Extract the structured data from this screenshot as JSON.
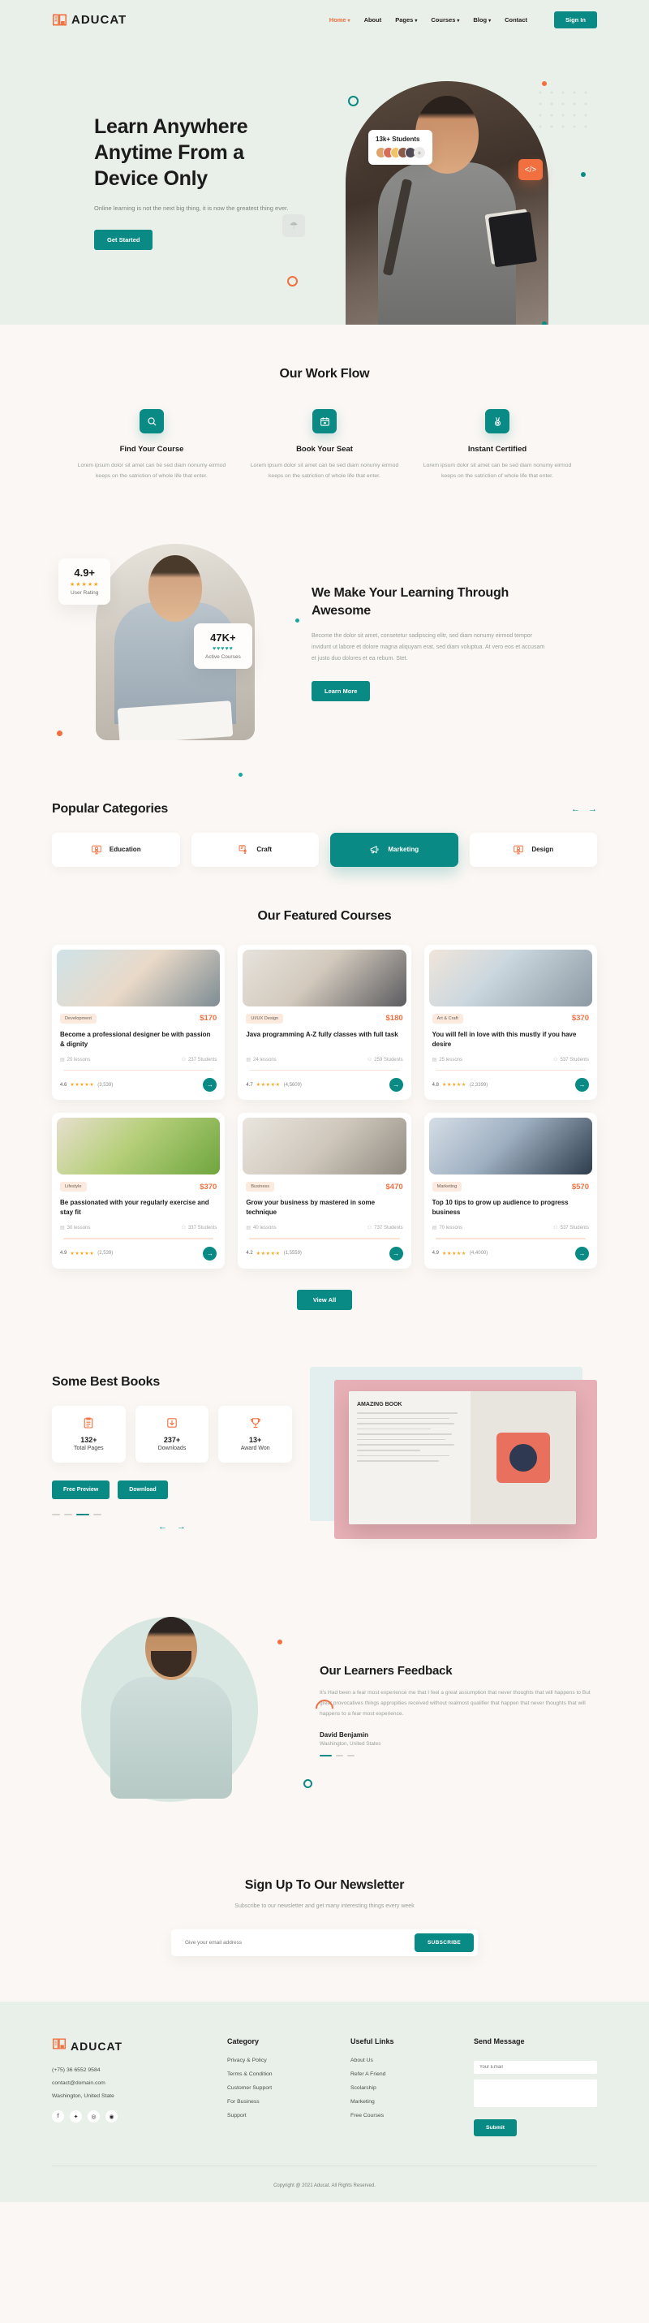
{
  "brand": {
    "name": "ADUCAT",
    "accent_teal": "#0a8a84",
    "accent_orange": "#f2703f"
  },
  "header": {
    "nav": [
      {
        "label": "Home",
        "caret": "▾",
        "active": true
      },
      {
        "label": "About",
        "caret": "",
        "active": false
      },
      {
        "label": "Pages",
        "caret": "▾",
        "active": false
      },
      {
        "label": "Courses",
        "caret": "▾",
        "active": false
      },
      {
        "label": "Blog",
        "caret": "▾",
        "active": false
      },
      {
        "label": "Contact",
        "caret": "",
        "active": false
      }
    ],
    "signin_label": "Sign In"
  },
  "hero": {
    "title": "Learn Anywhere Anytime From a Device Only",
    "subtitle": "Online learning is not the next big thing, it is now the greatest thing ever.",
    "cta": "Get Started",
    "students_badge": "13k+ Students",
    "more_avatars": "+",
    "code_icon": "</>",
    "grey_icon": "☂"
  },
  "workflow": {
    "title": "Our Work Flow",
    "items": [
      {
        "icon": "search-icon",
        "name": "Find Your Course",
        "desc": "Lorem ipsum dolor sit amet can be sed diam nonumy eirmod keeps on the satriction of whole life that enter."
      },
      {
        "icon": "calendar-icon",
        "name": "Book Your Seat",
        "desc": "Lorem ipsum dolor sit amet can be sed diam nonumy eirmod keeps on the satriction of whole life that enter."
      },
      {
        "icon": "medal-icon",
        "name": "Instant Certified",
        "desc": "Lorem ipsum dolor sit amet can be sed diam nonumy eirmod keeps on the satriction of whole life that enter."
      }
    ]
  },
  "learning": {
    "rating_value": "4.9+",
    "rating_stars": "★★★★★",
    "rating_caption": "User Rating",
    "courses_value": "47K+",
    "courses_hearts": "♥♥♥♥♥",
    "courses_caption": "Active Courses",
    "title": "We Make Your Learning Through Awesome",
    "paragraph": "Become the dolor sit amet, consetetur sadipscing elitr, sed diam nonumy eirmod tempor invidunt ut labore et dolore magna aliquyam erat, sed diam voluptua. At vero eos et accusam et justo duo dolores et ea rebum. Stet.",
    "cta": "Learn More"
  },
  "categories": {
    "title": "Popular Categories",
    "prev": "←",
    "next": "→",
    "items": [
      {
        "label": "Education",
        "icon": "monitor-badge-icon",
        "active": false
      },
      {
        "label": "Craft",
        "icon": "craft-icon",
        "active": false
      },
      {
        "label": "Marketing",
        "icon": "megaphone-icon",
        "active": true
      },
      {
        "label": "Design",
        "icon": "monitor-badge-icon",
        "active": false
      }
    ]
  },
  "courses": {
    "title": "Our Featured Courses",
    "view_all": "View All",
    "lessons_icon": "book-icon",
    "students_icon": "people-icon",
    "arrow_icon": "→",
    "items": [
      {
        "tag": "Development",
        "price": "$170",
        "title": "Become a professional designer be with passion & dignity",
        "lessons": "20 lessons",
        "students": "237 Students",
        "score": "4.6",
        "stars": "★★★★★",
        "count": "(3,539)",
        "thumb": "linear-gradient(135deg,#cfe3e8 0%,#e9d9c8 48%,#7d8c93 100%)"
      },
      {
        "tag": "UI/UX Design",
        "price": "$180",
        "title": "Java programming A-Z fully classes with full task",
        "lessons": "24 lessons",
        "students": "259 Students",
        "score": "4.7",
        "stars": "★★★★★",
        "count": "(4,5609)",
        "thumb": "linear-gradient(135deg,#e6e2dc 0%,#d3cabd 45%,#5b5b5f 100%)"
      },
      {
        "tag": "Art & Craft",
        "price": "$370",
        "title": "You will fell in love with this mustly if you have desire",
        "lessons": "25 lessons",
        "students": "537 Students",
        "score": "4.8",
        "stars": "★★★★★",
        "count": "(2,3399)",
        "thumb": "linear-gradient(135deg,#f0e5da 0%,#cbd7df 40%,#8e9aa3 100%)"
      },
      {
        "tag": "Lifestyle",
        "price": "$370",
        "title": "Be passionated with your regularly exercise and stay fit",
        "lessons": "30 lessons",
        "students": "337 Students",
        "score": "4.9",
        "stars": "★★★★★",
        "count": "(2,539)",
        "thumb": "linear-gradient(135deg,#e8dfcf 0%,#b6cf7a 45%,#6ea53e 100%)"
      },
      {
        "tag": "Business",
        "price": "$470",
        "title": "Grow your business by mastered in some technique",
        "lessons": "40 lessons",
        "students": "737 Students",
        "score": "4.2",
        "stars": "★★★★★",
        "count": "(1,5559)",
        "thumb": "linear-gradient(135deg,#e9e5de 0%,#cfc7bc 50%,#8f8a80 100%)"
      },
      {
        "tag": "Marketing",
        "price": "$570",
        "title": "Top 10 tips to grow up audience to progress business",
        "lessons": "70 lessons",
        "students": "537 Students",
        "score": "4.9",
        "stars": "★★★★★",
        "count": "(4,4000)",
        "thumb": "linear-gradient(135deg,#d5dde6 0%,#9fb0c2 45%,#2e3c4c 100%)"
      }
    ]
  },
  "books": {
    "title": "Some Best Books",
    "stats": [
      {
        "icon": "clipboard-icon",
        "number": "132+",
        "label": "Total Pages"
      },
      {
        "icon": "download-icon",
        "number": "237+",
        "label": "Downloads"
      },
      {
        "icon": "trophy-icon",
        "number": "13+",
        "label": "Award Won"
      }
    ],
    "preview_btn": "Free Preview",
    "download_btn": "Download",
    "book_page_title": "AMAZING BOOK",
    "prev": "←",
    "next": "→"
  },
  "feedback": {
    "title": "Our Learners Feedback",
    "quote": "It's Had been a fear most experience me that I feel a great assumption that never thoughts that will happens to But great provocatives things appropities received without realmost qualifier that happen that never thoughts that will happens to a fear most experience.",
    "author": "David Benjamin",
    "location": "Washington, United States"
  },
  "newsletter": {
    "title": "Sign Up To Our Newsletter",
    "subtitle": "Subscribe to our newsletter and get many interesting things every week",
    "placeholder": "Give your email address",
    "button": "SUBSCRIBE"
  },
  "footer": {
    "phone": "(+75) 36 6552 9584",
    "email": "contact@domain.com",
    "address": "Washington, United State",
    "social": [
      {
        "name": "facebook-icon",
        "glyph": "f"
      },
      {
        "name": "twitter-icon",
        "glyph": "✦"
      },
      {
        "name": "instagram-icon",
        "glyph": "◎"
      },
      {
        "name": "pinterest-icon",
        "glyph": "◉"
      }
    ],
    "category_heading": "Category",
    "category_links": [
      "Privacy & Policy",
      "Terms & Condition",
      "Customer Support",
      "For Business",
      "Support"
    ],
    "useful_heading": "Useful Links",
    "useful_links": [
      "About Us",
      "Refer A Friend",
      "Scolarship",
      "Marketing",
      "Free Courses"
    ],
    "message_heading": "Send Message",
    "email_placeholder": "Your Email",
    "message_placeholder": "",
    "submit": "Submit",
    "copyright": "Copyright @ 2021 Aducat. All Rights Reserved."
  }
}
